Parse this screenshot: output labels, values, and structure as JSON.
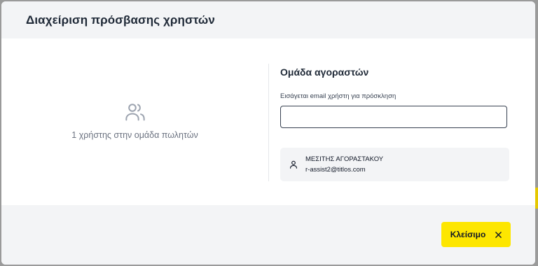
{
  "dialog": {
    "title": "Διαχείριση πρόσβασης χρηστών"
  },
  "sellers": {
    "count_text": "1 χρήστης στην ομάδα πωλητών",
    "icon": "users-icon"
  },
  "buyers": {
    "title": "Ομάδα αγοραστών",
    "invite_label": "Εισάγεται email χρήστη για πρόσκληση",
    "invite_value": "",
    "invite_placeholder": "",
    "members": [
      {
        "icon": "user-icon",
        "name": "ΜΕΣΙΤΗΣ ΑΓΟΡΑΣΤΑΚΟΥ",
        "email": "r-assist2@titlos.com"
      }
    ]
  },
  "footer": {
    "close_label": "Κλείσιμο",
    "close_icon": "close-icon"
  },
  "colors": {
    "accent": "#fde600",
    "header_bg": "#f3f4f6",
    "body_bg": "#ffffff",
    "text": "#1f2937",
    "muted": "#6b7280"
  }
}
